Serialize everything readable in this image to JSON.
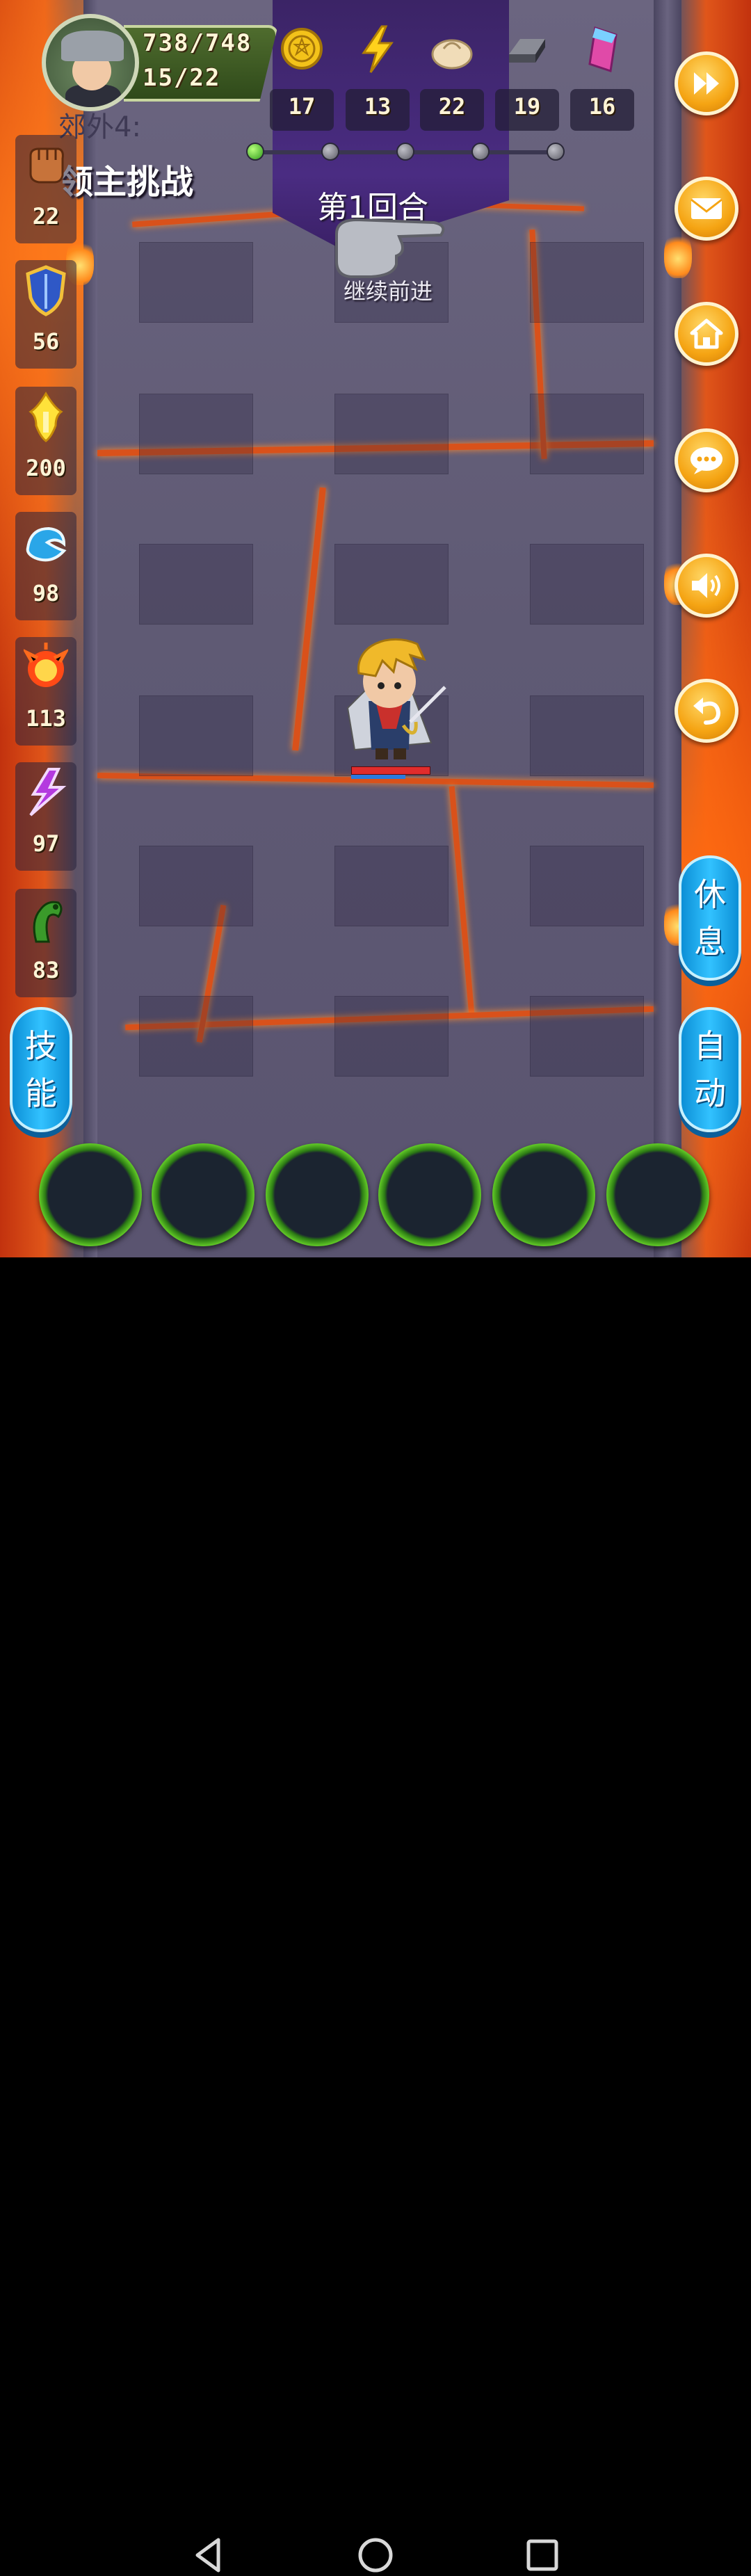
{
  "player": {
    "hp": "738/748",
    "level_progress": "15/22"
  },
  "resources": [
    {
      "name": "coin-icon",
      "value": "17"
    },
    {
      "name": "energy-icon",
      "value": "13"
    },
    {
      "name": "bun-icon",
      "value": "22"
    },
    {
      "name": "iron-ingot-icon",
      "value": "19"
    },
    {
      "name": "crystal-icon",
      "value": "16"
    }
  ],
  "stage": {
    "name": "郊外4:",
    "boss_title": "领主挑战",
    "round": "第1回合",
    "hint": "继续前进",
    "progress_total": 5,
    "progress_current": 1
  },
  "attributes": [
    {
      "name": "fist-icon",
      "value": "22"
    },
    {
      "name": "shield-icon",
      "value": "56"
    },
    {
      "name": "holy-flame-icon",
      "value": "200"
    },
    {
      "name": "water-icon",
      "value": "98"
    },
    {
      "name": "fire-icon",
      "value": "113"
    },
    {
      "name": "lightning-icon",
      "value": "97"
    },
    {
      "name": "poison-icon",
      "value": "83"
    }
  ],
  "side_buttons": {
    "fast_forward": "fast-forward-icon",
    "mail": "mail-icon",
    "home": "home-icon",
    "chat": "chat-icon",
    "sound": "sound-icon",
    "back": "back-icon"
  },
  "actions": {
    "skill": "技能",
    "rest": "休息",
    "auto": "自动"
  },
  "colors": {
    "lava": "#e0561a",
    "stone": "#6b6580",
    "orange_button": "#f5a413",
    "blue_button": "#32c2ff"
  }
}
